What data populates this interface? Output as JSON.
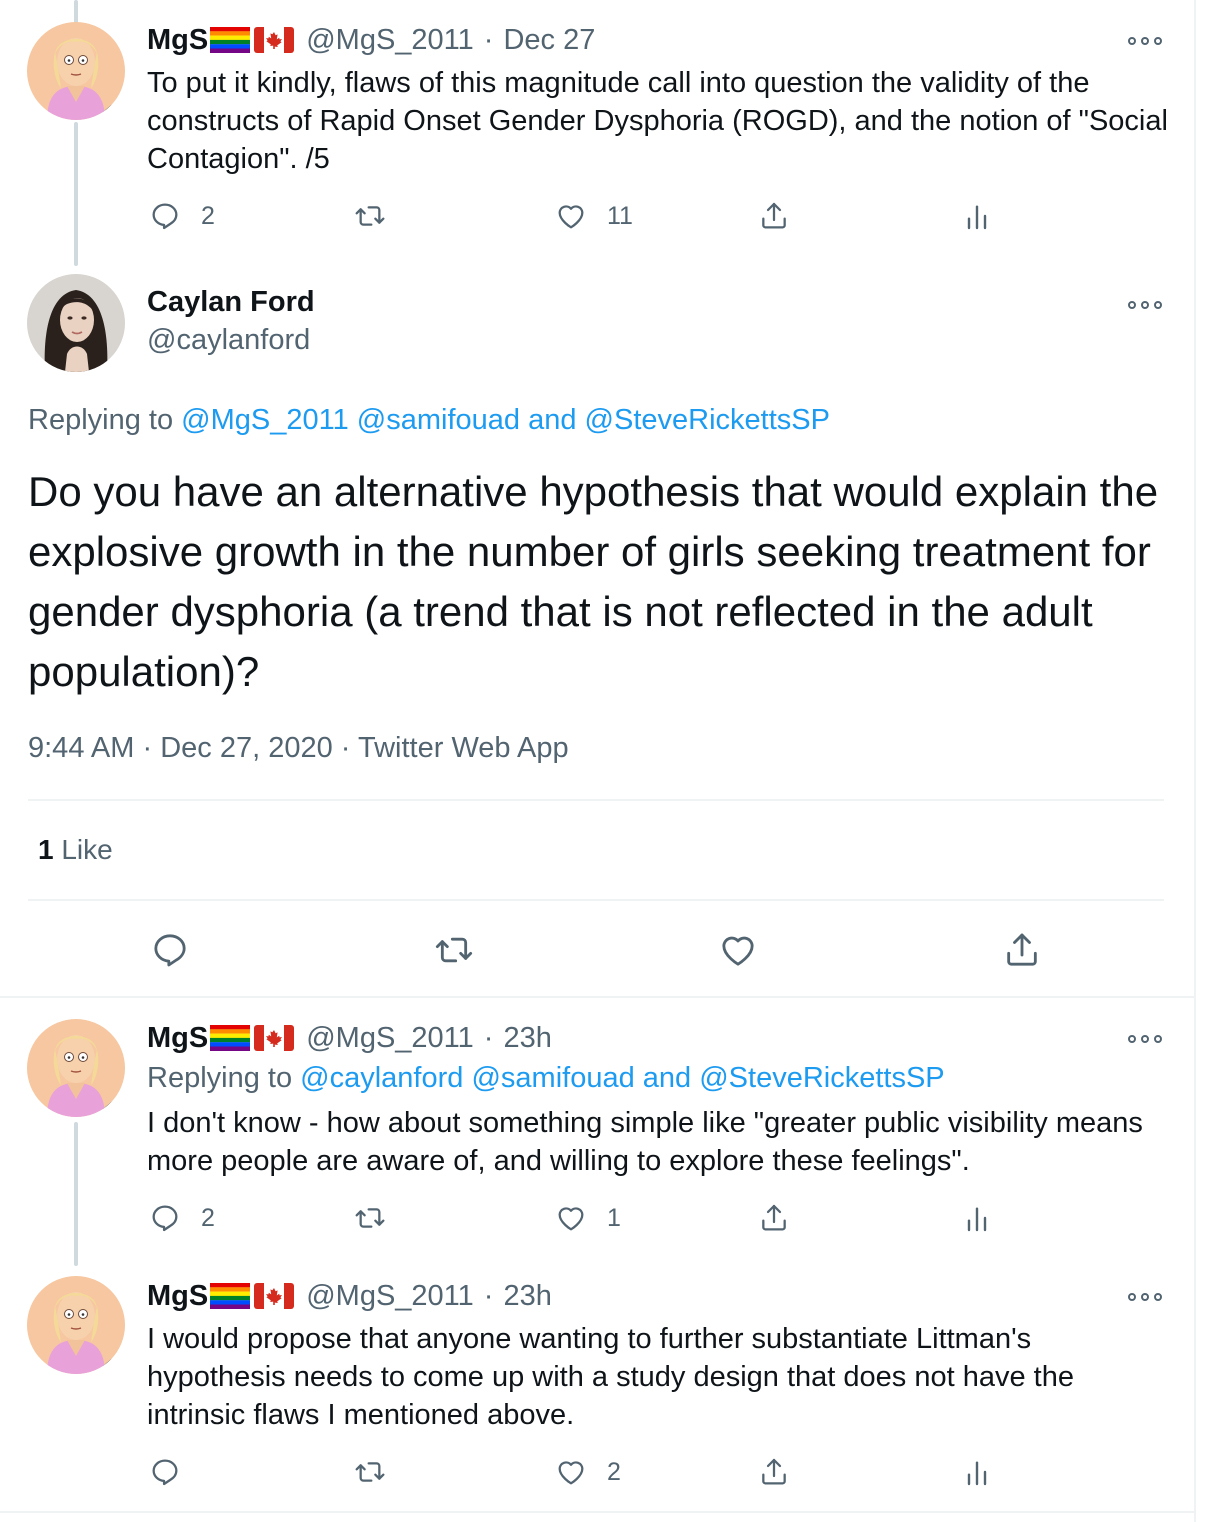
{
  "tweets": [
    {
      "name": "MgS",
      "handle": "@MgS_2011",
      "time": "Dec 27",
      "text": "To put it kindly, flaws of this magnitude call into question the validity of the constructs of Rapid Onset Gender Dysphoria (ROGD), and the notion of \"Social Contagion\".  /5",
      "actions": {
        "replies": "2",
        "retweets": "",
        "likes": "11"
      }
    },
    {
      "name": "MgS",
      "handle": "@MgS_2011",
      "time": "23h",
      "replying_prefix": "Replying to",
      "replying_to": [
        "@caylanford",
        "@samifouad"
      ],
      "replying_and": "and",
      "replying_last": "@SteveRickettsSP",
      "text": "I don't know - how about something simple like \"greater public visibility means more people are aware of, and willing to explore these feelings\".",
      "actions": {
        "replies": "2",
        "retweets": "",
        "likes": "1"
      }
    },
    {
      "name": "MgS",
      "handle": "@MgS_2011",
      "time": "23h",
      "text": "I would propose that anyone wanting to further substantiate Littman's hypothesis needs to come up with a study design that does not have the intrinsic flaws I mentioned above.",
      "actions": {
        "replies": "",
        "retweets": "",
        "likes": "2"
      }
    }
  ],
  "main": {
    "name": "Caylan Ford",
    "handle": "@caylanford",
    "replying_prefix": "Replying to",
    "replying_to": [
      "@MgS_2011",
      "@samifouad"
    ],
    "replying_and": "and",
    "replying_last": "@SteveRickettsSP",
    "text": "Do you have an alternative hypothesis that would explain the explosive growth in the number of girls seeking treatment for gender dysphoria (a trend that is not reflected in the adult population)?",
    "time": "9:44 AM",
    "date": "Dec 27, 2020",
    "source": "Twitter Web App",
    "like_count": "1",
    "like_label": "Like"
  },
  "separator": "·",
  "icons": {
    "reply": "reply-icon",
    "retweet": "retweet-icon",
    "like": "heart-icon",
    "share": "share-icon",
    "analytics": "analytics-icon",
    "more": "more-icon",
    "flags": [
      "rainbow-flag-icon",
      "canada-flag-icon"
    ]
  },
  "colors": {
    "link": "#1d9bf0",
    "muted": "#536471",
    "text": "#0f1419",
    "thread": "#cfd9de"
  }
}
